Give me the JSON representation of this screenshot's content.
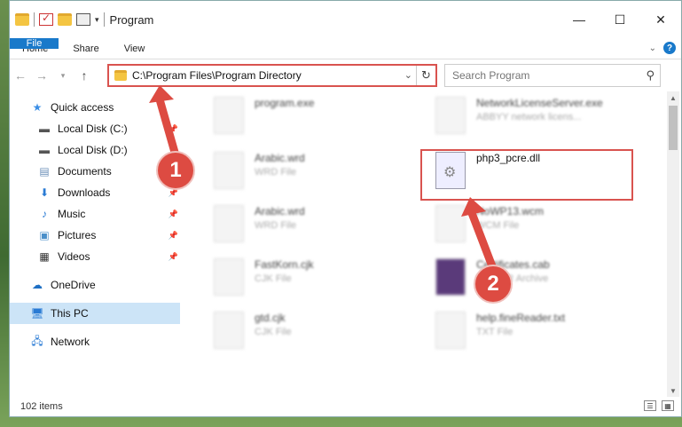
{
  "window": {
    "title": "Program"
  },
  "ribbon": {
    "tabs": [
      "File",
      "Home",
      "Share",
      "View"
    ],
    "help": "?"
  },
  "address": {
    "path": "C:\\Program Files\\Program Directory",
    "search_placeholder": "Search Program"
  },
  "sidebar": {
    "items": [
      {
        "label": "Quick access",
        "icon": "star-icon",
        "pinned": false
      },
      {
        "label": "Local Disk (C:)",
        "icon": "drive-icon",
        "pinned": true
      },
      {
        "label": "Local Disk (D:)",
        "icon": "drive-icon",
        "pinned": true
      },
      {
        "label": "Documents",
        "icon": "documents-icon",
        "pinned": true
      },
      {
        "label": "Downloads",
        "icon": "download-icon",
        "pinned": true
      },
      {
        "label": "Music",
        "icon": "music-icon",
        "pinned": true
      },
      {
        "label": "Pictures",
        "icon": "pictures-icon",
        "pinned": true
      },
      {
        "label": "Videos",
        "icon": "video-icon",
        "pinned": true
      },
      {
        "label": "OneDrive",
        "icon": "cloud-icon",
        "pinned": false
      },
      {
        "label": "This PC",
        "icon": "computer-icon",
        "pinned": false
      },
      {
        "label": "Network",
        "icon": "network-icon",
        "pinned": false
      }
    ]
  },
  "files": [
    {
      "name": "program.exe",
      "type": ""
    },
    {
      "name": "NetworkLicenseServer.exe",
      "type": "ABBYY network licens..."
    },
    {
      "name": "Arabic.wrd",
      "type": "WRD File"
    },
    {
      "name": "php3_pcre.dll",
      "type": ""
    },
    {
      "name": "Arabic.wrd",
      "type": "WRD File"
    },
    {
      "name": "NoWP13.wcm",
      "type": "WCM File"
    },
    {
      "name": "FastKorn.cjk",
      "type": "CJK File"
    },
    {
      "name": "Certificates.cab",
      "type": "WinRAR Archive"
    },
    {
      "name": "gtd.cjk",
      "type": "CJK File"
    },
    {
      "name": "help.fineReader.txt",
      "type": "TXT File"
    }
  ],
  "status": {
    "item_count": "102 items"
  },
  "callouts": {
    "step1": "1",
    "step2": "2"
  },
  "colors": {
    "accent": "#1979ca",
    "highlight": "#d9534f",
    "selected": "#cce4f7"
  }
}
